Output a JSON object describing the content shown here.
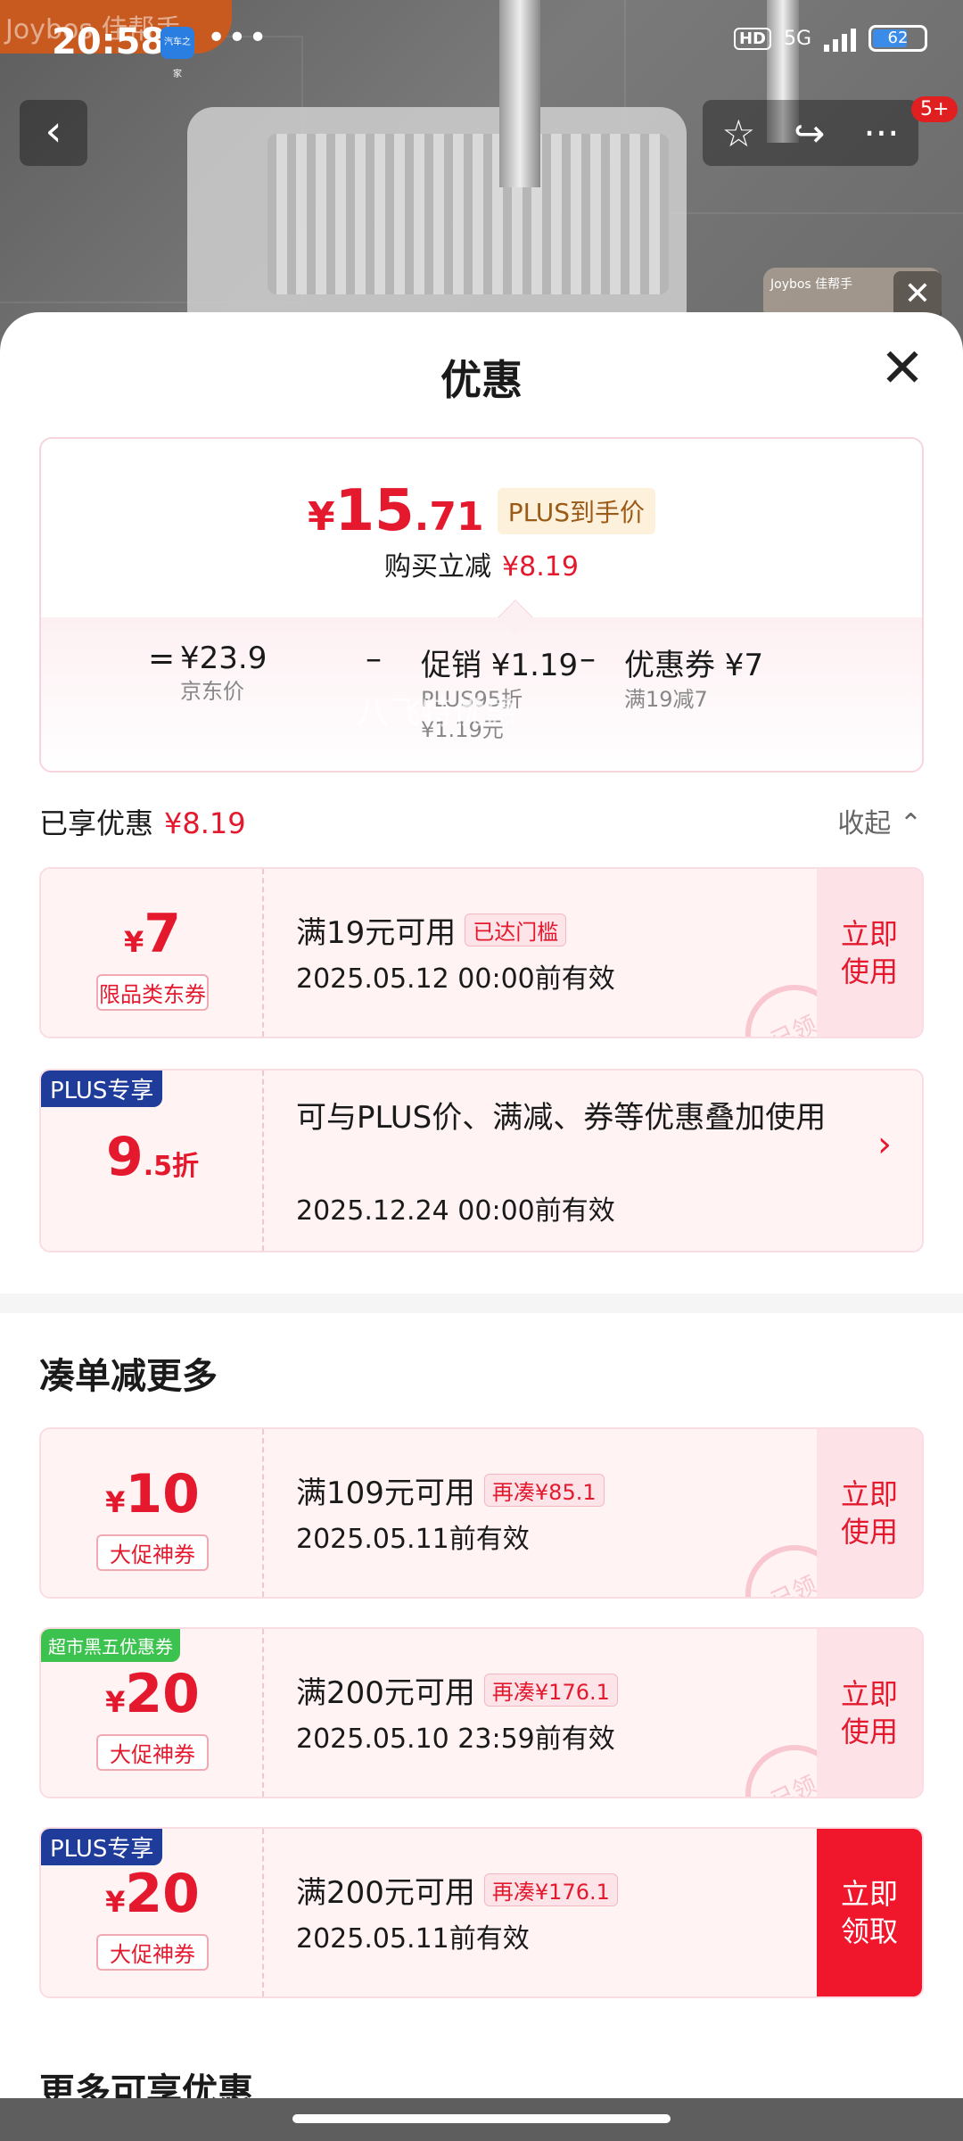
{
  "status_bar": {
    "time": "20:58",
    "app_icon_label": "汽车之家",
    "more": "•••",
    "hd": "HD",
    "network": "5G",
    "battery": "62"
  },
  "background": {
    "watermark_top": "Joybos 佳帮手",
    "mini_video_brand": "Joybos 佳帮手",
    "notification_count": "5+"
  },
  "nav": {
    "back": "‹",
    "favorite": "☆",
    "share": "↪",
    "more": "···",
    "close": "✕"
  },
  "sheet": {
    "title": "优惠",
    "close": "✕"
  },
  "price_summary": {
    "currency": "¥",
    "final_int": "15",
    "final_dec": ".71",
    "final_label": "PLUS到手价",
    "reduce_label": "购买立减",
    "reduce_amount": "¥8.19",
    "eq": "=",
    "items": [
      {
        "main": "¥23.9",
        "sub1": "京东价",
        "sub2": ""
      },
      {
        "main": "促销 ¥1.19",
        "sub1": "PLUS95折",
        "sub2": "¥1.19元"
      },
      {
        "main": "优惠券 ¥7",
        "sub1": "满19减7",
        "sub2": ""
      }
    ],
    "minus": "–"
  },
  "enjoyed": {
    "label": "已享优惠",
    "amount": "¥8.19",
    "collapse": "收起 ⌃"
  },
  "coupons_enjoyed": [
    {
      "currency": "¥",
      "value": "7",
      "kind": "限品类东券",
      "condition": "满19元可用",
      "tag": "已达门槛",
      "valid": "2025.05.12 00:00前有效",
      "action": "立即\n使用",
      "stamp": "已领"
    }
  ],
  "plus_discount": {
    "corner": "PLUS专享",
    "value": "9",
    "suffix": ".5折",
    "desc": "可与PLUS价、满减、券等优惠叠加使用",
    "valid": "2025.12.24 00:00前有效",
    "arrow": "›"
  },
  "overlay_watermark": "八飞特优惠",
  "section_more": {
    "title": "凑单减更多"
  },
  "coupons_more": [
    {
      "corner": "",
      "currency": "¥",
      "value": "10",
      "kind": "大促神券",
      "condition": "满109元可用",
      "tag": "再凑¥85.1",
      "valid": "2025.05.11前有效",
      "action": "立即\n使用",
      "stamp": "已领"
    },
    {
      "corner": "超市黑五优惠券",
      "currency": "¥",
      "value": "20",
      "kind": "大促神券",
      "condition": "满200元可用",
      "tag": "再凑¥176.1",
      "valid": "2025.05.10 23:59前有效",
      "action": "立即\n使用",
      "stamp": "已领"
    },
    {
      "corner": "PLUS专享",
      "currency": "¥",
      "value": "20",
      "kind": "大促神券",
      "condition": "满200元可用",
      "tag": "再凑¥176.1",
      "valid": "2025.05.11前有效",
      "action": "立即\n领取",
      "stamp": ""
    }
  ],
  "section_extra": {
    "title": "更多可享优惠"
  },
  "colors": {
    "accent_red": "#e4192d",
    "plus_blue": "#1f3c9a",
    "green_badge": "#3cc24e"
  }
}
